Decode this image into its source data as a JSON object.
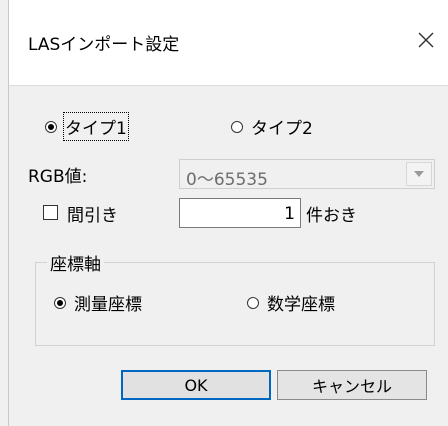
{
  "dialog": {
    "title": "LASインポート設定",
    "close_icon": "close-icon"
  },
  "type_group": {
    "options": [
      {
        "label": "タイプ1",
        "checked": true
      },
      {
        "label": "タイプ2",
        "checked": false
      }
    ]
  },
  "rgb": {
    "label": "RGB値:",
    "value": "0〜65535",
    "enabled": false
  },
  "thinning": {
    "label": "間引き",
    "checked": false,
    "value": "1",
    "suffix": "件おき"
  },
  "coordinate_axis": {
    "legend": "座標軸",
    "options": [
      {
        "label": "測量座標",
        "checked": true
      },
      {
        "label": "数学座標",
        "checked": false
      }
    ]
  },
  "buttons": {
    "ok": "OK",
    "cancel": "キャンセル"
  }
}
